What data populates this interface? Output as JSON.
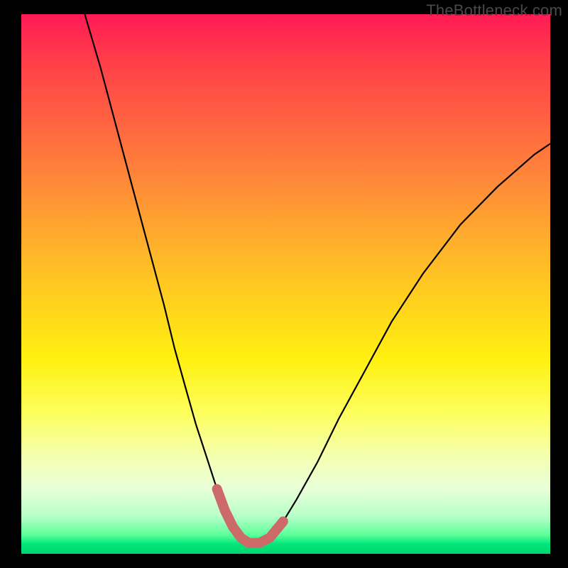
{
  "watermark": "TheBottleneck.com",
  "chart_data": {
    "type": "line",
    "title": "",
    "xlabel": "",
    "ylabel": "",
    "xlim": [
      0,
      100
    ],
    "ylim": [
      0,
      100
    ],
    "series": [
      {
        "name": "bottleneck-curve",
        "x": [
          12,
          15,
          18,
          21,
          24,
          27,
          29,
          31,
          33,
          35,
          37,
          38.5,
          40,
          41.5,
          43,
          45,
          47,
          49.5,
          52,
          56,
          60,
          65,
          70,
          76,
          83,
          90,
          97,
          100
        ],
        "values": [
          100,
          90,
          79,
          68,
          57,
          46,
          38,
          31,
          24,
          18,
          12,
          8,
          5,
          3,
          2,
          2,
          3,
          6,
          10,
          17,
          25,
          34,
          43,
          52,
          61,
          68,
          74,
          76
        ]
      },
      {
        "name": "highlight-segment",
        "x": [
          37,
          38.5,
          40,
          41.5,
          43,
          45,
          47,
          49.5
        ],
        "values": [
          12,
          8,
          5,
          3,
          2,
          2,
          3,
          6
        ]
      }
    ],
    "colors": {
      "curve": "#000000",
      "highlight": "#cc6a6a",
      "gradient_top": "#ff1a55",
      "gradient_bottom": "#00d670"
    }
  }
}
